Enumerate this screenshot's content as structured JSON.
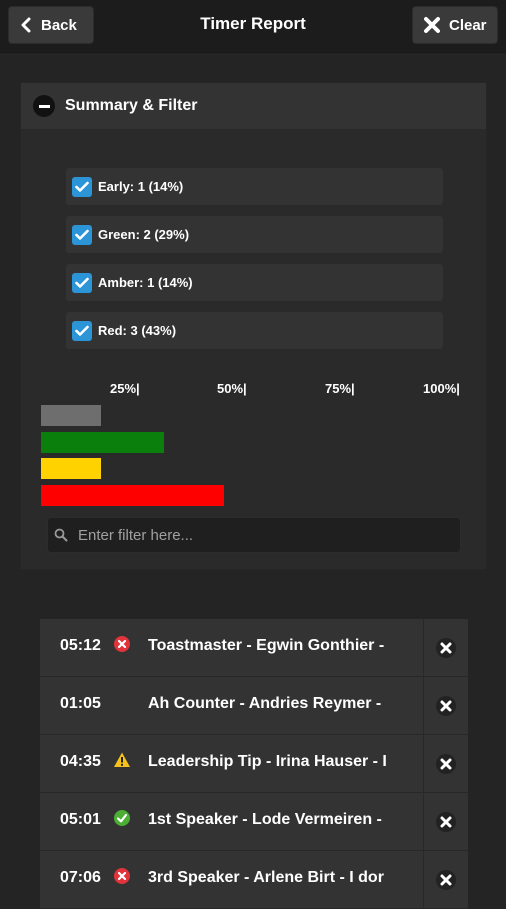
{
  "header": {
    "title": "Timer Report",
    "back_label": "Back",
    "clear_label": "Clear"
  },
  "summary": {
    "heading": "Summary & Filter",
    "filters": [
      {
        "label": "Early: 1 (14%)",
        "checked": true
      },
      {
        "label": "Green: 2 (29%)",
        "checked": true
      },
      {
        "label": "Amber: 1 (14%)",
        "checked": true
      },
      {
        "label": "Red: 3 (43%)",
        "checked": true
      }
    ],
    "scale": [
      "25%|",
      "50%|",
      "75%|",
      "100%|"
    ],
    "bars": [
      {
        "name": "Early",
        "percent": 14,
        "color": "#6e6e6e"
      },
      {
        "name": "Green",
        "percent": 29,
        "color": "#0b7f0b"
      },
      {
        "name": "Amber",
        "percent": 14,
        "color": "#ffd200"
      },
      {
        "name": "Red",
        "percent": 43,
        "color": "#ff0000"
      }
    ],
    "filter_placeholder": "Enter filter here..."
  },
  "report": [
    {
      "time": "05:12",
      "status": "red",
      "text": "Toastmaster - Egwin Gonthier -"
    },
    {
      "time": "01:05",
      "status": "none",
      "text": "Ah Counter - Andries Reymer -"
    },
    {
      "time": "04:35",
      "status": "amber",
      "text": "Leadership Tip - Irina Hauser - I"
    },
    {
      "time": "05:01",
      "status": "green",
      "text": "1st Speaker - Lode Vermeiren -"
    },
    {
      "time": "07:06",
      "status": "red",
      "text": "3rd Speaker - Arlene Birt - I dor"
    }
  ],
  "colors": {
    "accent": "#2b95d8",
    "early": "#6e6e6e",
    "green": "#0b7f0b",
    "amber": "#ffd200",
    "red": "#ff0000"
  }
}
